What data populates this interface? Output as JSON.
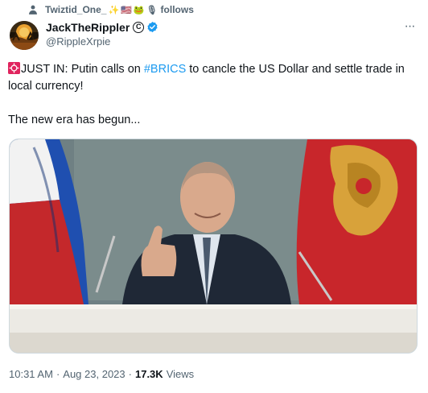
{
  "social_context": {
    "username": "Twiztid_One_",
    "follows": "follows",
    "emojis": [
      "✨",
      "🇺🇸",
      "🐸",
      "🎙"
    ]
  },
  "author": {
    "display_name": "JackTheRippler",
    "handle": "@RippleXrpie"
  },
  "tweet": {
    "line1_prefix": "JUST IN: Putin calls on ",
    "hashtag": "#BRICS",
    "line1_suffix": " to cancle the US Dollar and settle trade in local currency!",
    "line2": "The new era has begun..."
  },
  "meta": {
    "time": "10:31 AM",
    "separator": "·",
    "date": "Aug 23, 2023",
    "views_count": "17.3K",
    "views_label": "Views"
  },
  "colors": {
    "link": "#1d9bf0",
    "secondary_text": "#536471",
    "verified": "#1d9bf0"
  },
  "icons": [
    "person-icon",
    "copyright-icon",
    "verified-badge-icon",
    "more-icon",
    "alert-icon"
  ]
}
